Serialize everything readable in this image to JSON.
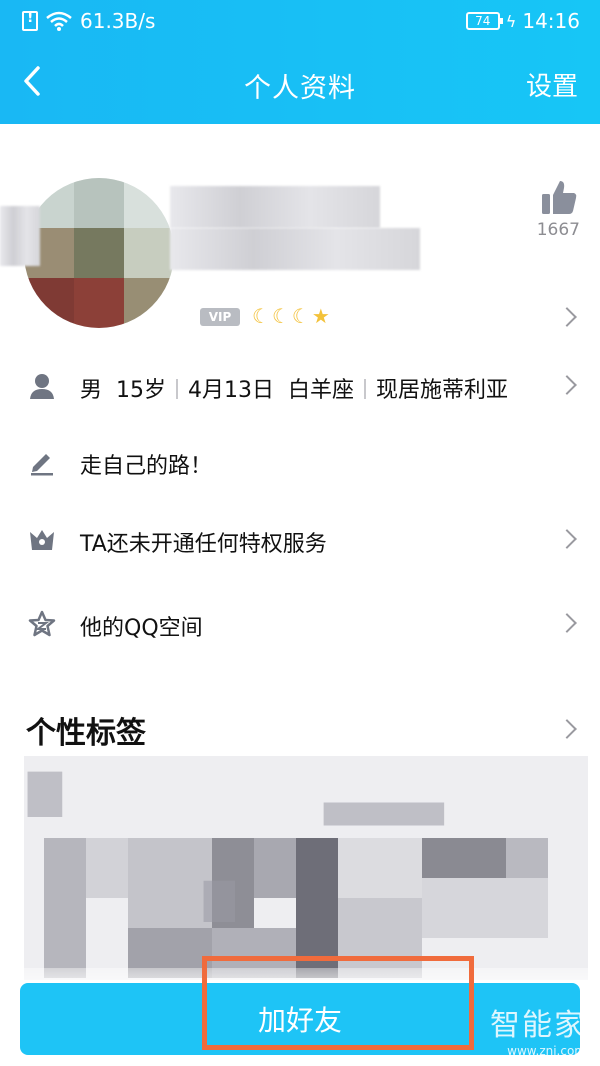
{
  "status_bar": {
    "network_speed": "61.3B/s",
    "battery": "74",
    "time": "14:16"
  },
  "nav": {
    "title": "个人资料",
    "settings": "设置"
  },
  "profile": {
    "vip": "VIP",
    "like_count": "1667"
  },
  "info_rows": {
    "basic": {
      "gender": "男",
      "age": "15岁",
      "birthday": "4月13日",
      "zodiac": "白羊座",
      "location": "现居施蒂利亚"
    },
    "signature": "走自己的路！",
    "privilege": "TA还未开通任何特权服务",
    "qzone": "他的QQ空间"
  },
  "tags": {
    "title": "个性标签"
  },
  "actions": {
    "add_friend": "加好友"
  },
  "watermark": {
    "name": "智能家",
    "url": "www.znj.com"
  },
  "colors": {
    "header": "#19b8f4",
    "button": "#1ec4f6",
    "highlight": "#f06b3c"
  }
}
